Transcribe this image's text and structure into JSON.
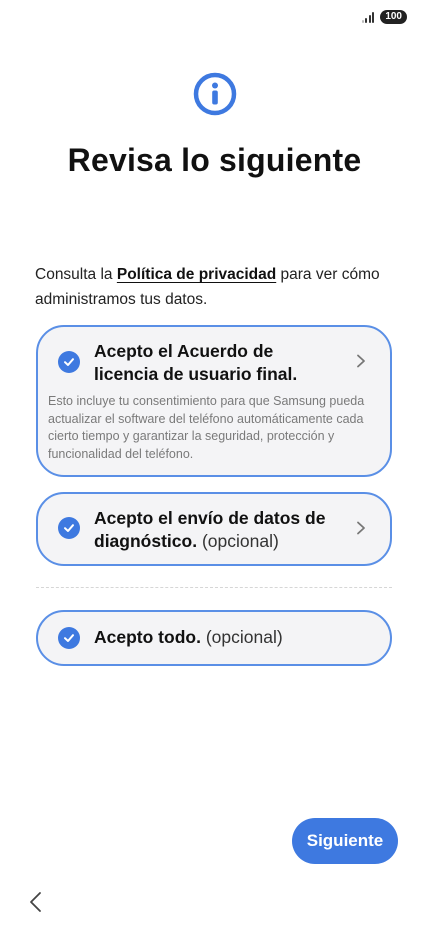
{
  "status_bar": {
    "battery": "100",
    "signal_icon": "signal-bars-icon"
  },
  "header": {
    "icon": "info-icon",
    "title": "Revisa lo siguiente"
  },
  "intro": {
    "text_before": "Consulta la ",
    "link": "Política de privacidad",
    "text_after": " para ver cómo administramos tus datos."
  },
  "agreements": [
    {
      "title": "Acepto el Acuerdo de licencia de usuario final.",
      "description": "Esto incluye tu consentimiento para que Samsung pueda actualizar el software del teléfono automáticamente cada cierto tiempo y garantizar la seguridad, protección y funcionalidad del teléfono.",
      "checked": true
    },
    {
      "title": "Acepto el envío de datos de diagnóstico.",
      "optional": "(opcional)",
      "checked": true
    },
    {
      "title": "Acepto todo.",
      "optional": "(opcional)",
      "checked": true
    }
  ],
  "footer": {
    "next_label": "Siguiente",
    "back_icon": "back-chevron-icon"
  },
  "colors": {
    "accent": "#3e79e0",
    "card_border": "#5a8fe6",
    "card_bg": "#f4f4f6"
  }
}
